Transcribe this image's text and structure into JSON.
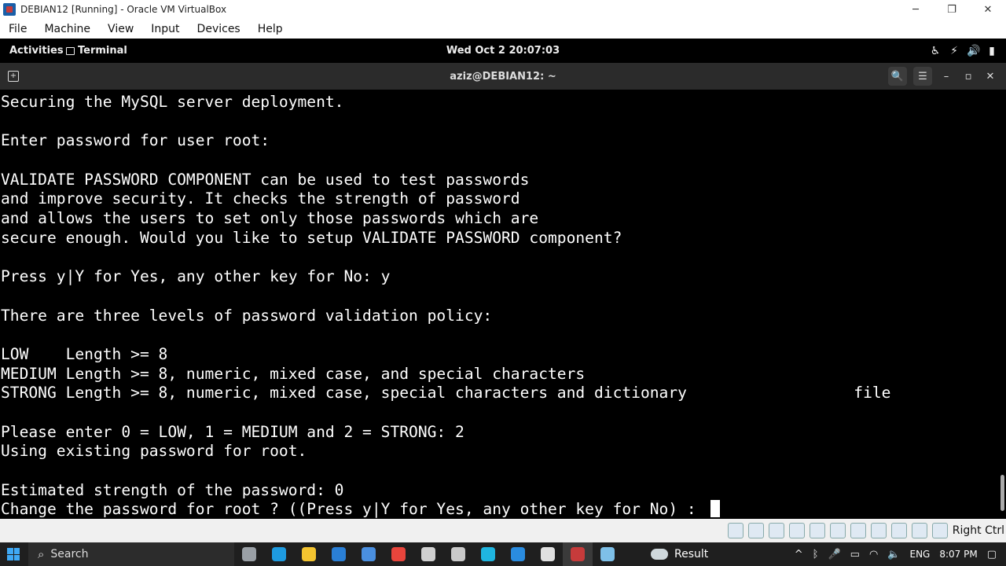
{
  "host_window": {
    "title": "DEBIAN12 [Running] - Oracle VM VirtualBox",
    "controls": {
      "minimize": "─",
      "restore": "❐",
      "close": "✕"
    }
  },
  "host_menu": {
    "items": [
      {
        "label": "File"
      },
      {
        "label": "Machine"
      },
      {
        "label": "View"
      },
      {
        "label": "Input"
      },
      {
        "label": "Devices"
      },
      {
        "label": "Help"
      }
    ]
  },
  "gnome_bar": {
    "activities": "Activities",
    "app_name": "Terminal",
    "clock": "Wed Oct 2  20:07:03",
    "tray_icons": [
      "accessibility-icon",
      "network-icon",
      "volume-icon",
      "power-icon"
    ]
  },
  "terminal": {
    "title": "aziz@DEBIAN12: ~",
    "header_buttons": [
      "search-icon",
      "hamburger-menu-icon",
      "minimize-icon",
      "maximize-icon",
      "close-icon"
    ],
    "lines": [
      "Securing the MySQL server deployment.",
      "",
      "Enter password for user root:",
      "",
      "VALIDATE PASSWORD COMPONENT can be used to test passwords",
      "and improve security. It checks the strength of password",
      "and allows the users to set only those passwords which are",
      "secure enough. Would you like to setup VALIDATE PASSWORD component?",
      "",
      "Press y|Y for Yes, any other key for No: y",
      "",
      "There are three levels of password validation policy:",
      "",
      "LOW    Length >= 8",
      "MEDIUM Length >= 8, numeric, mixed case, and special characters",
      "STRONG Length >= 8, numeric, mixed case, special characters and dictionary                  file",
      "",
      "Please enter 0 = LOW, 1 = MEDIUM and 2 = STRONG: 2",
      "Using existing password for root.",
      "",
      "Estimated strength of the password: 0",
      "Change the password for root ? ((Press y|Y for Yes, any other key for No) : "
    ]
  },
  "vbox_status": {
    "host_key": "Right Ctrl"
  },
  "taskbar": {
    "search_placeholder": "Search",
    "result_label": "Result",
    "language": "ENG",
    "time": "8:07 PM",
    "apps": [
      {
        "name": "task-view-icon",
        "color": "#9aa0a6"
      },
      {
        "name": "edge-icon",
        "color": "#1e9be0"
      },
      {
        "name": "file-explorer-icon",
        "color": "#f4c430"
      },
      {
        "name": "mail-icon",
        "color": "#2a7fd6"
      },
      {
        "name": "store-icon",
        "color": "#4a8fe0"
      },
      {
        "name": "chrome-icon",
        "color": "#e8453c"
      },
      {
        "name": "openai-icon",
        "color": "#d0d0d0"
      },
      {
        "name": "3d-viewer-icon",
        "color": "#c9c9c9"
      },
      {
        "name": "circle-app-icon",
        "color": "#1fb5e0"
      },
      {
        "name": "vscode-icon",
        "color": "#2a8ce0"
      },
      {
        "name": "media-player-icon",
        "color": "#e0e0e0"
      },
      {
        "name": "virtualbox-icon",
        "color": "#c63b3b"
      },
      {
        "name": "notepad-icon",
        "color": "#7ec0e8"
      }
    ]
  }
}
